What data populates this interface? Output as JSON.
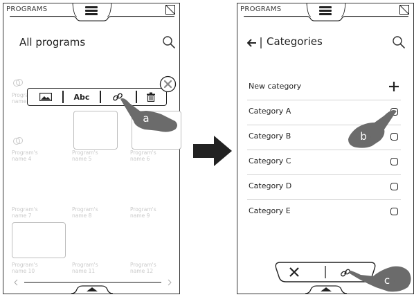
{
  "left_screen": {
    "topbar_title": "PROGRAMS",
    "title": "All programs",
    "toolbar": {
      "text_label": "Abc"
    },
    "callout": "a",
    "programs": [
      {
        "label": "Program's\nname 1"
      },
      {
        "label": "Program's\nname 4"
      },
      {
        "label": "Program's\nname 5"
      },
      {
        "label": "Program's\nname 6"
      },
      {
        "label": "Program's\nname 7"
      },
      {
        "label": "Program's\nname 8"
      },
      {
        "label": "Program's\nname 9"
      },
      {
        "label": "Program's\nname 10"
      },
      {
        "label": "Program's\nname 11"
      },
      {
        "label": "Program's\nname 12"
      }
    ]
  },
  "right_screen": {
    "topbar_title": "PROGRAMS",
    "title": "Categories",
    "new_category": "New category",
    "categories": [
      "Category A",
      "Category B",
      "Category C",
      "Category D",
      "Category E"
    ],
    "callouts": [
      "b",
      "c"
    ]
  },
  "colors": {
    "ink": "#222222",
    "callout_fill": "#6b6b6b",
    "faded_text": "#c9c9c9",
    "divider": "#d2d2d2"
  }
}
